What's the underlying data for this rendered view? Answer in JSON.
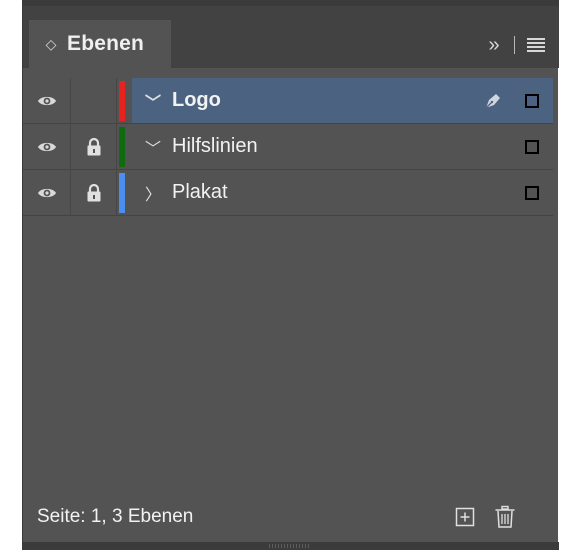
{
  "panel": {
    "tab_label": "Ebenen",
    "tab_chevron": "◇",
    "collapse_glyph": "»",
    "icons": {
      "collapse": "double-chevron-right-icon",
      "menu": "hamburger-menu-icon",
      "visibility": "eye-icon",
      "lock": "lock-icon",
      "pen": "pen-nib-icon",
      "new_layer": "new-layer-icon",
      "delete": "trash-icon"
    }
  },
  "layers": [
    {
      "name": "Logo",
      "visible": true,
      "locked": false,
      "color": "#e8231f",
      "expanded": true,
      "expander_glyph": "﹀",
      "selected": true,
      "targeted": true
    },
    {
      "name": "Hilfslinien",
      "visible": true,
      "locked": true,
      "color": "#0e6b10",
      "expanded": true,
      "expander_glyph": "﹀",
      "selected": false,
      "targeted": false
    },
    {
      "name": "Plakat",
      "visible": true,
      "locked": true,
      "color": "#4a8ff0",
      "expanded": false,
      "expander_glyph": "〉",
      "selected": false,
      "targeted": false
    }
  ],
  "status": {
    "text": "Seite: 1, 3 Ebenen"
  },
  "colors": {
    "panel_bg": "#535353",
    "tabbar_bg": "#424242",
    "selection": "#4b6280",
    "text": "#f2f2f2"
  }
}
